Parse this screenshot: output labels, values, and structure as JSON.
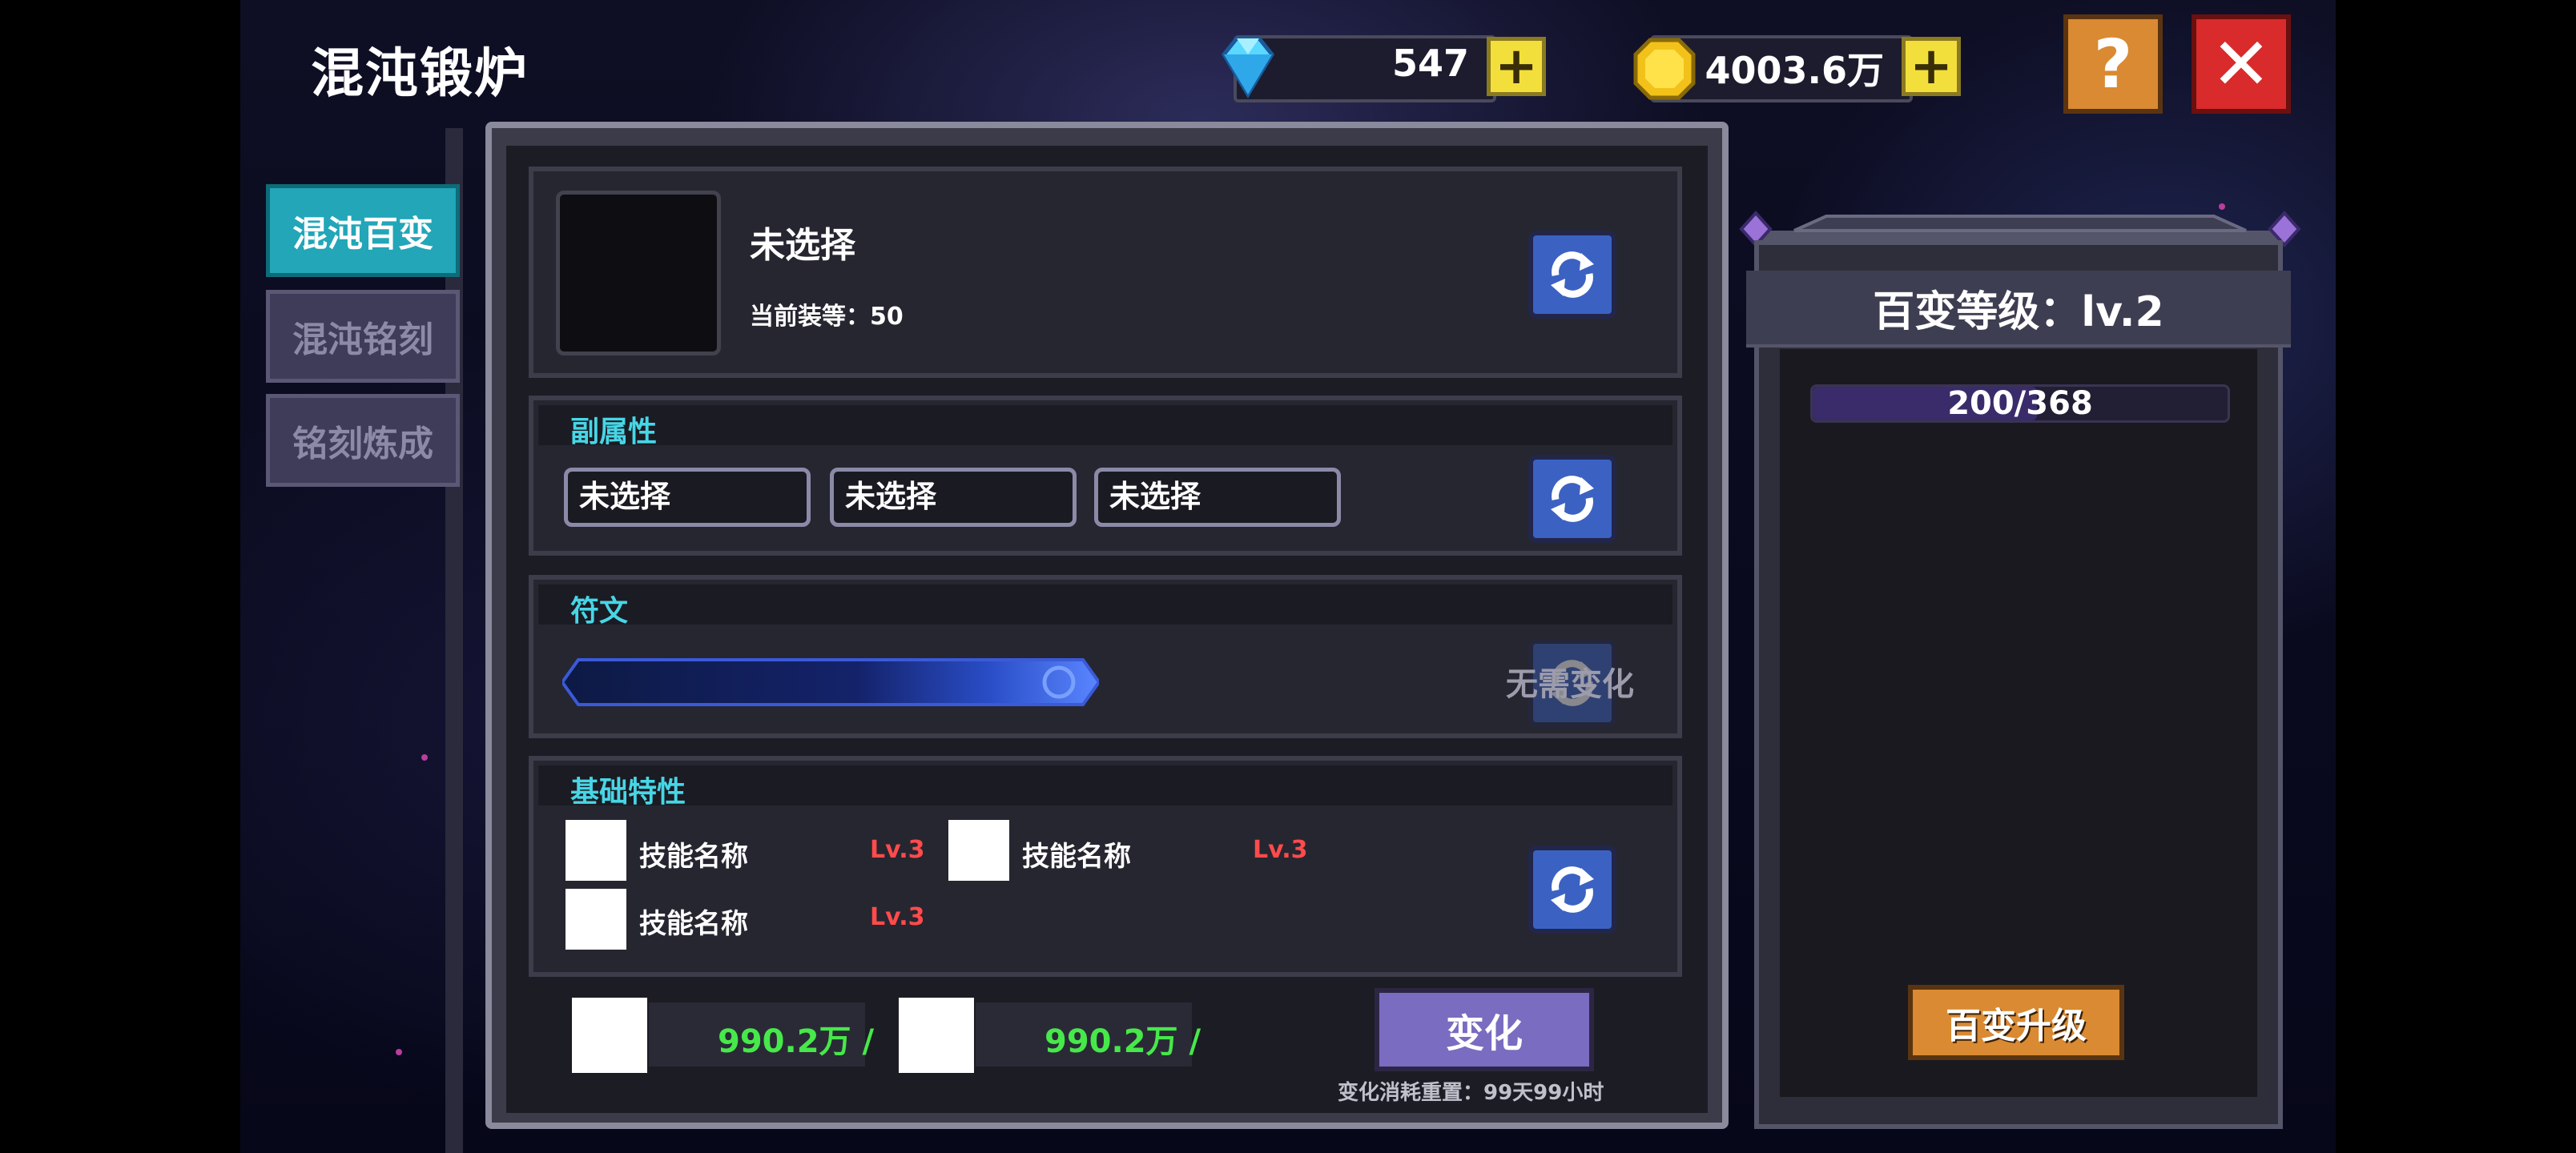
{
  "title": "混沌锻炉",
  "resources": {
    "gems": "547",
    "gold": "4003.6万",
    "plus_symbol": "+"
  },
  "header_buttons": {
    "help": "?",
    "close": "✕"
  },
  "tabs": [
    {
      "label": "混沌百变",
      "active": true
    },
    {
      "label": "混沌铭刻",
      "active": false
    },
    {
      "label": "铭刻炼成",
      "active": false
    }
  ],
  "equipment": {
    "name": "未选择",
    "level_text": "当前装等：50"
  },
  "sub_attributes": {
    "title": "副属性",
    "slots": [
      "未选择",
      "未选择",
      "未选择"
    ]
  },
  "rune": {
    "title": "符文",
    "status": "无需变化"
  },
  "base_traits": {
    "title": "基础特性",
    "skills": [
      {
        "name": "技能名称",
        "level": "Lv.3"
      },
      {
        "name": "技能名称",
        "level": "Lv.3"
      },
      {
        "name": "技能名称",
        "level": "Lv.3"
      }
    ]
  },
  "costs": [
    "990.2万 /",
    "990.2万 /"
  ],
  "change_button": "变化",
  "reset_note": "变化消耗重置：99天99小时",
  "side_panel": {
    "title": "百变等级：lv.2",
    "progress": "200/368",
    "progress_fraction": 0.54,
    "upgrade_button": "百变升级"
  },
  "colors": {
    "accent_cyan": "#47d6e6",
    "active_tab": "#22a6b8",
    "level_red": "#ff4b4b",
    "cost_green": "#47e84a",
    "close_red": "#d92b2b",
    "help_orange": "#d98a32",
    "refresh_blue": "#3b62c2"
  },
  "icons": {
    "gem": "diamond-icon",
    "gold": "coin-icon",
    "refresh": "refresh-icon"
  }
}
